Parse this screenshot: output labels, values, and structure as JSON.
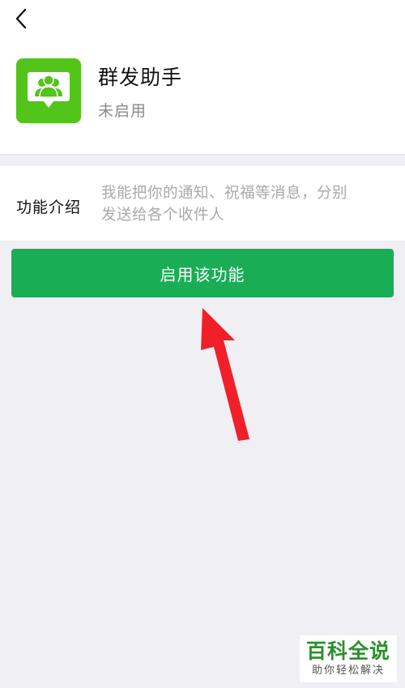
{
  "app": {
    "name": "群发助手",
    "status": "未启用",
    "icon": "group-broadcast-icon",
    "accent": "#52c41a"
  },
  "intro": {
    "label": "功能介绍",
    "text_line1": "我能把你的通知、祝福等消息，分别",
    "text_line2": "发送给各个收件人"
  },
  "action": {
    "enable_label": "启用该功能",
    "color": "#1aad56"
  },
  "annotation": {
    "arrow_color": "#f0202a"
  },
  "watermark": {
    "title": "百科全说",
    "subtitle": "助你轻松解决"
  }
}
